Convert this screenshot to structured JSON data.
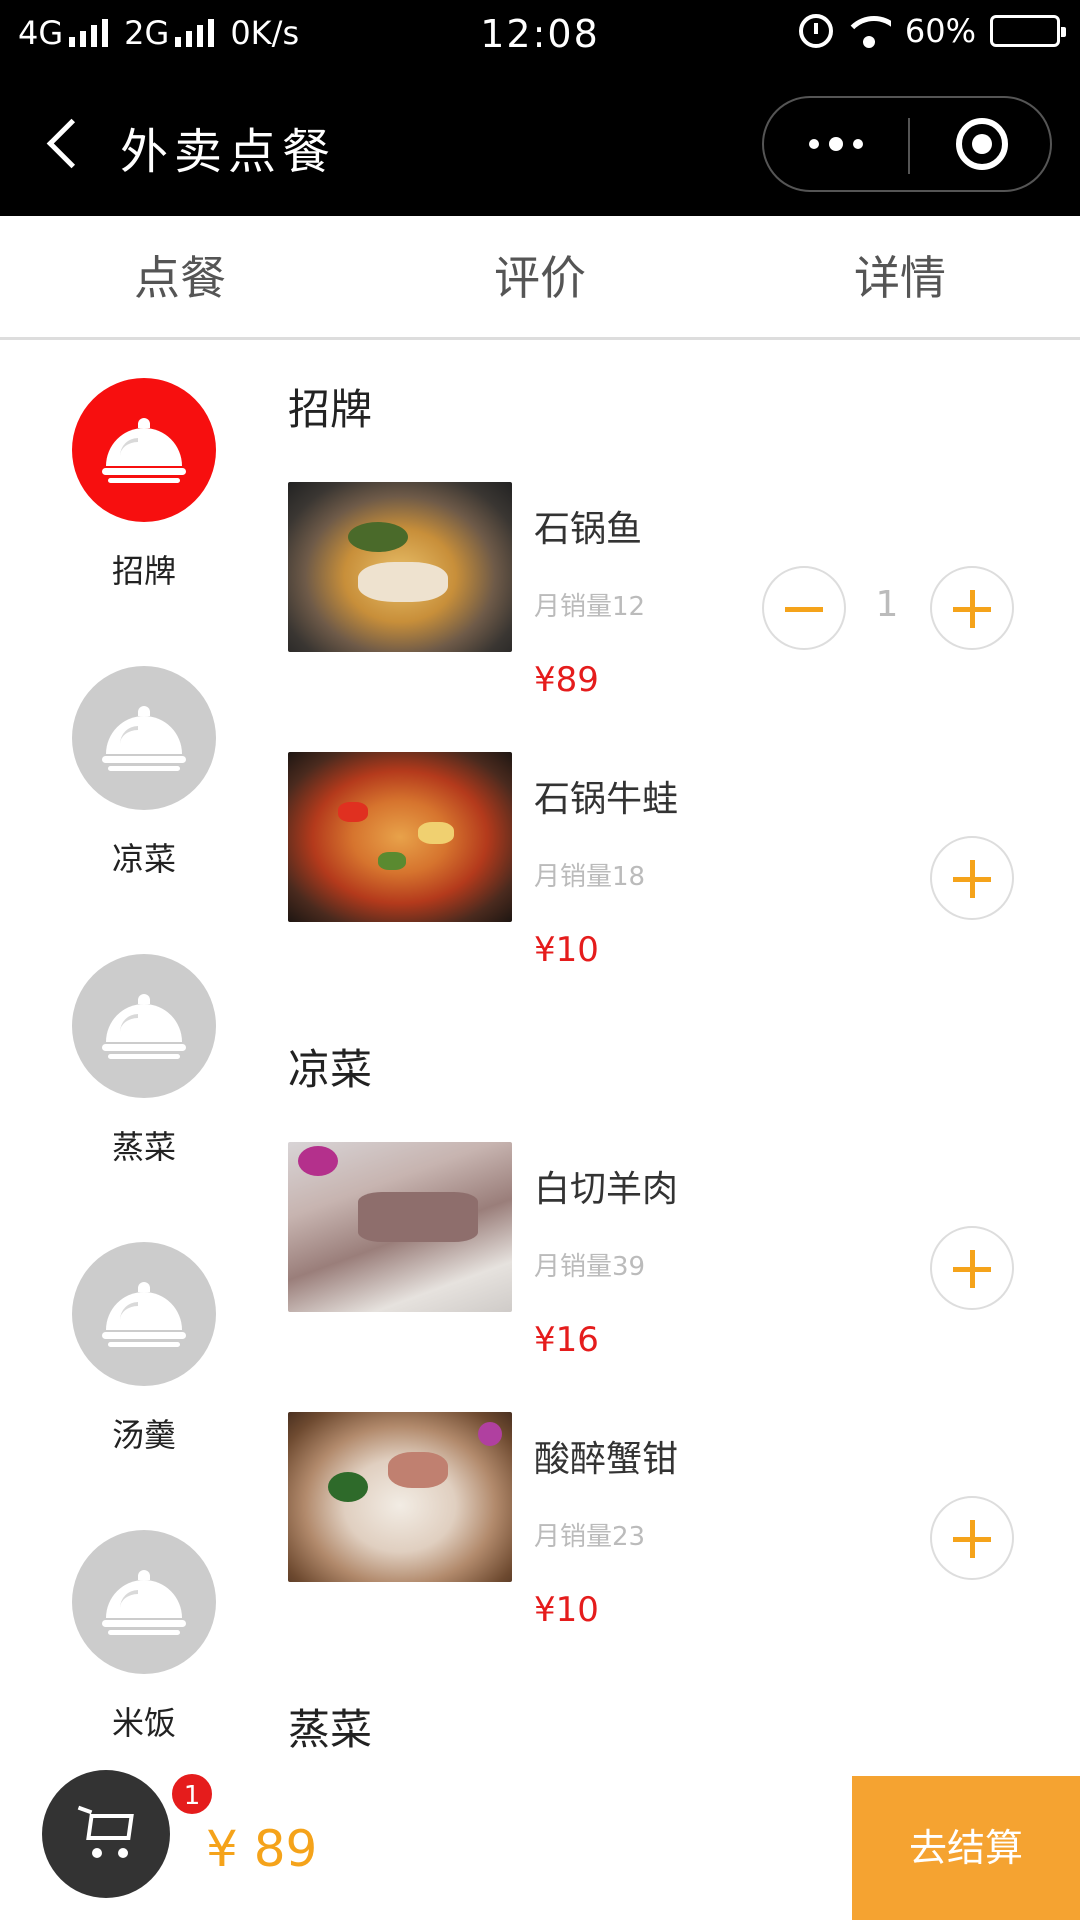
{
  "status_bar": {
    "network1": "4G",
    "network2": "2G",
    "speed": "0K/s",
    "time": "12:08",
    "battery": "60%"
  },
  "nav": {
    "title": "外卖点餐"
  },
  "tabs": [
    {
      "label": "点餐"
    },
    {
      "label": "评价"
    },
    {
      "label": "详情"
    }
  ],
  "categories": [
    {
      "label": "招牌",
      "active": true
    },
    {
      "label": "凉菜",
      "active": false
    },
    {
      "label": "蒸菜",
      "active": false
    },
    {
      "label": "汤羹",
      "active": false
    },
    {
      "label": "米饭",
      "active": false
    }
  ],
  "sections": [
    {
      "title": "招牌",
      "items": [
        {
          "name": "石锅鱼",
          "sales": "月销量12",
          "price": "¥89",
          "quantity": "1"
        },
        {
          "name": "石锅牛蛙",
          "sales": "月销量18",
          "price": "¥10"
        }
      ]
    },
    {
      "title": "凉菜",
      "items": [
        {
          "name": "白切羊肉",
          "sales": "月销量39",
          "price": "¥16"
        },
        {
          "name": "酸醉蟹钳",
          "sales": "月销量23",
          "price": "¥10"
        }
      ]
    },
    {
      "title": "蒸菜",
      "items": []
    }
  ],
  "cart": {
    "badge": "1",
    "total": "¥ 89",
    "checkout_label": "去结算"
  },
  "colors": {
    "accent": "#f5a31a",
    "price": "#e51c1c",
    "active_category": "#f70f0f"
  }
}
